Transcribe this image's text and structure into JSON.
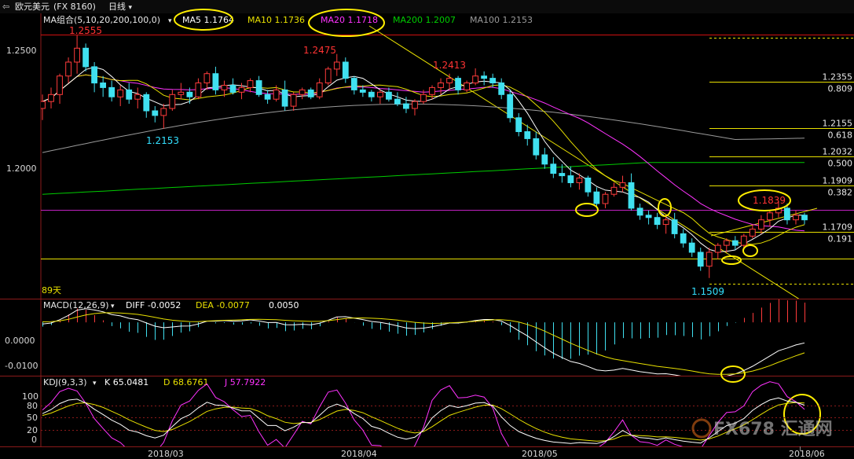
{
  "titlebar": {
    "back_icon": "back-arrow-icon",
    "instrument": "欧元美元",
    "code": "(FX 8160)",
    "period": "日线"
  },
  "main_legend": {
    "label": "MA组合(5,10,20,200,100,0)",
    "ma5": "MA5 1.1764",
    "ma10": "MA10 1.1736",
    "ma20": "MA20 1.1718",
    "ma200": "MA200 1.2007",
    "ma100": "MA100 1.2153",
    "colors": {
      "label": "#e8e8e8",
      "ma5": "#ffffff",
      "ma10": "#e8e000",
      "ma20": "#ff33ff",
      "ma200": "#00cc00",
      "ma100": "#9a9a9a"
    }
  },
  "price_axis": {
    "labels": [
      "1.2500",
      "1.2000"
    ],
    "values": [
      1.25,
      1.2
    ]
  },
  "price_annotations": {
    "high1": "1.2555",
    "high2": "1.2475",
    "high3": "1.2413",
    "low1": "1.2153",
    "low2": "1.1509",
    "recent_high": "1.1839",
    "days": "89天"
  },
  "fibonacci": [
    {
      "price": "1.2355",
      "ratio": "0.809",
      "value": 1.2355
    },
    {
      "price": "1.2155",
      "ratio": "0.618",
      "value": 1.2155
    },
    {
      "price": "1.2032",
      "ratio": "0.500",
      "value": 1.2032
    },
    {
      "price": "1.1909",
      "ratio": "0.382",
      "value": 1.1909
    },
    {
      "price": "1.1709",
      "ratio": "0.191",
      "value": 1.1709
    }
  ],
  "macd": {
    "label": "MACD(12,26,9)",
    "diff": "DIFF -0.0052",
    "dea": "DEA -0.0077",
    "macd": "0.0050",
    "axis_labels": [
      "0.0000",
      "-0.0100"
    ],
    "axis_values": [
      0.0,
      -0.01
    ]
  },
  "kdj": {
    "label": "KDJ(9,3,3)",
    "k": "K 65.0481",
    "d": "D 68.6761",
    "j": "J 57.7922",
    "axis_labels": [
      "100",
      "80",
      "50",
      "20",
      "0"
    ],
    "axis_values": [
      100,
      80,
      50,
      20,
      0
    ]
  },
  "x_axis": {
    "labels": [
      "2018/03",
      "2018/04",
      "2018/05",
      "2018/06"
    ]
  },
  "watermark": "FX678 汇通网",
  "chart_data": {
    "type": "candlestick",
    "instrument": "欧元美元 (FX 8160)",
    "period": "日线",
    "candles_ohlc": [
      [
        1.224,
        1.23,
        1.219,
        1.227
      ],
      [
        1.227,
        1.233,
        1.224,
        1.23
      ],
      [
        1.23,
        1.239,
        1.226,
        1.238
      ],
      [
        1.238,
        1.246,
        1.235,
        1.244
      ],
      [
        1.244,
        1.2555,
        1.239,
        1.25
      ],
      [
        1.25,
        1.252,
        1.24,
        1.242
      ],
      [
        1.242,
        1.244,
        1.231,
        1.235
      ],
      [
        1.235,
        1.238,
        1.229,
        1.233
      ],
      [
        1.233,
        1.236,
        1.227,
        1.229
      ],
      [
        1.229,
        1.234,
        1.225,
        1.232
      ],
      [
        1.232,
        1.235,
        1.226,
        1.228
      ],
      [
        1.228,
        1.233,
        1.224,
        1.23
      ],
      [
        1.23,
        1.231,
        1.22,
        1.223
      ],
      [
        1.223,
        1.225,
        1.218,
        1.221
      ],
      [
        1.221,
        1.226,
        1.2153,
        1.224
      ],
      [
        1.224,
        1.232,
        1.223,
        1.23
      ],
      [
        1.23,
        1.235,
        1.228,
        1.231
      ],
      [
        1.231,
        1.233,
        1.226,
        1.229
      ],
      [
        1.229,
        1.237,
        1.228,
        1.235
      ],
      [
        1.235,
        1.24,
        1.232,
        1.239
      ],
      [
        1.239,
        1.242,
        1.23,
        1.232
      ],
      [
        1.232,
        1.236,
        1.229,
        1.234
      ],
      [
        1.234,
        1.237,
        1.23,
        1.231
      ],
      [
        1.231,
        1.235,
        1.228,
        1.233
      ],
      [
        1.233,
        1.237,
        1.231,
        1.236
      ],
      [
        1.236,
        1.238,
        1.229,
        1.23
      ],
      [
        1.23,
        1.232,
        1.226,
        1.228
      ],
      [
        1.228,
        1.234,
        1.227,
        1.232
      ],
      [
        1.232,
        1.236,
        1.223,
        1.225
      ],
      [
        1.225,
        1.231,
        1.223,
        1.23
      ],
      [
        1.23,
        1.233,
        1.228,
        1.232
      ],
      [
        1.232,
        1.233,
        1.228,
        1.229
      ],
      [
        1.229,
        1.237,
        1.228,
        1.235
      ],
      [
        1.235,
        1.242,
        1.234,
        1.241
      ],
      [
        1.241,
        1.2475,
        1.238,
        1.244
      ],
      [
        1.244,
        1.246,
        1.235,
        1.237
      ],
      [
        1.237,
        1.238,
        1.23,
        1.232
      ],
      [
        1.232,
        1.234,
        1.229,
        1.231
      ],
      [
        1.231,
        1.232,
        1.227,
        1.229
      ],
      [
        1.229,
        1.232,
        1.226,
        1.231
      ],
      [
        1.231,
        1.233,
        1.227,
        1.228
      ],
      [
        1.228,
        1.231,
        1.225,
        1.226
      ],
      [
        1.226,
        1.229,
        1.222,
        1.224
      ],
      [
        1.224,
        1.228,
        1.221,
        1.227
      ],
      [
        1.227,
        1.232,
        1.226,
        1.23
      ],
      [
        1.23,
        1.234,
        1.228,
        1.233
      ],
      [
        1.233,
        1.237,
        1.23,
        1.235
      ],
      [
        1.235,
        1.239,
        1.232,
        1.237
      ],
      [
        1.237,
        1.238,
        1.23,
        1.232
      ],
      [
        1.232,
        1.236,
        1.231,
        1.235
      ],
      [
        1.235,
        1.2413,
        1.234,
        1.238
      ],
      [
        1.238,
        1.24,
        1.234,
        1.237
      ],
      [
        1.237,
        1.239,
        1.233,
        1.235
      ],
      [
        1.235,
        1.237,
        1.228,
        1.23
      ],
      [
        1.23,
        1.232,
        1.218,
        1.22
      ],
      [
        1.22,
        1.222,
        1.212,
        1.214
      ],
      [
        1.214,
        1.217,
        1.208,
        1.211
      ],
      [
        1.211,
        1.214,
        1.202,
        1.204
      ],
      [
        1.204,
        1.207,
        1.198,
        1.2
      ],
      [
        1.2,
        1.203,
        1.194,
        1.196
      ],
      [
        1.196,
        1.2,
        1.192,
        1.195
      ],
      [
        1.195,
        1.199,
        1.19,
        1.192
      ],
      [
        1.192,
        1.196,
        1.189,
        1.194
      ],
      [
        1.194,
        1.195,
        1.186,
        1.188
      ],
      [
        1.188,
        1.19,
        1.181,
        1.183
      ],
      [
        1.183,
        1.188,
        1.181,
        1.187
      ],
      [
        1.187,
        1.192,
        1.186,
        1.19
      ],
      [
        1.19,
        1.195,
        1.188,
        1.192
      ],
      [
        1.192,
        1.196,
        1.18,
        1.181
      ],
      [
        1.181,
        1.183,
        1.176,
        1.178
      ],
      [
        1.178,
        1.18,
        1.174,
        1.177
      ],
      [
        1.177,
        1.179,
        1.172,
        1.174
      ],
      [
        1.174,
        1.178,
        1.17,
        1.176
      ],
      [
        1.176,
        1.179,
        1.168,
        1.17
      ],
      [
        1.17,
        1.172,
        1.164,
        1.166
      ],
      [
        1.166,
        1.168,
        1.16,
        1.162
      ],
      [
        1.162,
        1.164,
        1.154,
        1.156
      ],
      [
        1.156,
        1.164,
        1.1509,
        1.162
      ],
      [
        1.162,
        1.166,
        1.159,
        1.165
      ],
      [
        1.165,
        1.168,
        1.162,
        1.167
      ],
      [
        1.167,
        1.169,
        1.163,
        1.165
      ],
      [
        1.165,
        1.17,
        1.164,
        1.169
      ],
      [
        1.169,
        1.174,
        1.168,
        1.172
      ],
      [
        1.172,
        1.178,
        1.17,
        1.176
      ],
      [
        1.176,
        1.18,
        1.173,
        1.179
      ],
      [
        1.179,
        1.1839,
        1.177,
        1.181
      ],
      [
        1.181,
        1.183,
        1.174,
        1.176
      ],
      [
        1.176,
        1.18,
        1.174,
        1.178
      ],
      [
        1.178,
        1.179,
        1.174,
        1.176
      ]
    ],
    "moving_averages": {
      "MA5": 1.1764,
      "MA10": 1.1736,
      "MA20": 1.1718,
      "MA200": 1.2007,
      "MA100": 1.2153
    },
    "fibonacci_levels": {
      "0.809": 1.2355,
      "0.618": 1.2155,
      "0.500": 1.2032,
      "0.382": 1.1909,
      "0.191": 1.1709
    },
    "annotated_points": {
      "high_1": 1.2555,
      "high_2": 1.2475,
      "high_3": 1.2413,
      "low_1": 1.2153,
      "low_2": 1.1509,
      "recent_high": 1.1839
    },
    "price_ylim": [
      1.142,
      1.265
    ],
    "macd_values": {
      "DIFF": -0.0052,
      "DEA": -0.0077,
      "MACD": 0.005
    },
    "macd_ylim": [
      -0.0135,
      0.006
    ],
    "kdj_values": {
      "K": 65.0481,
      "D": 68.6761,
      "J": 57.7922
    },
    "kdj_ylim": [
      -5,
      115
    ],
    "x_tick_labels": [
      "2018/03",
      "2018/04",
      "2018/05",
      "2018/06"
    ],
    "grid": false
  }
}
